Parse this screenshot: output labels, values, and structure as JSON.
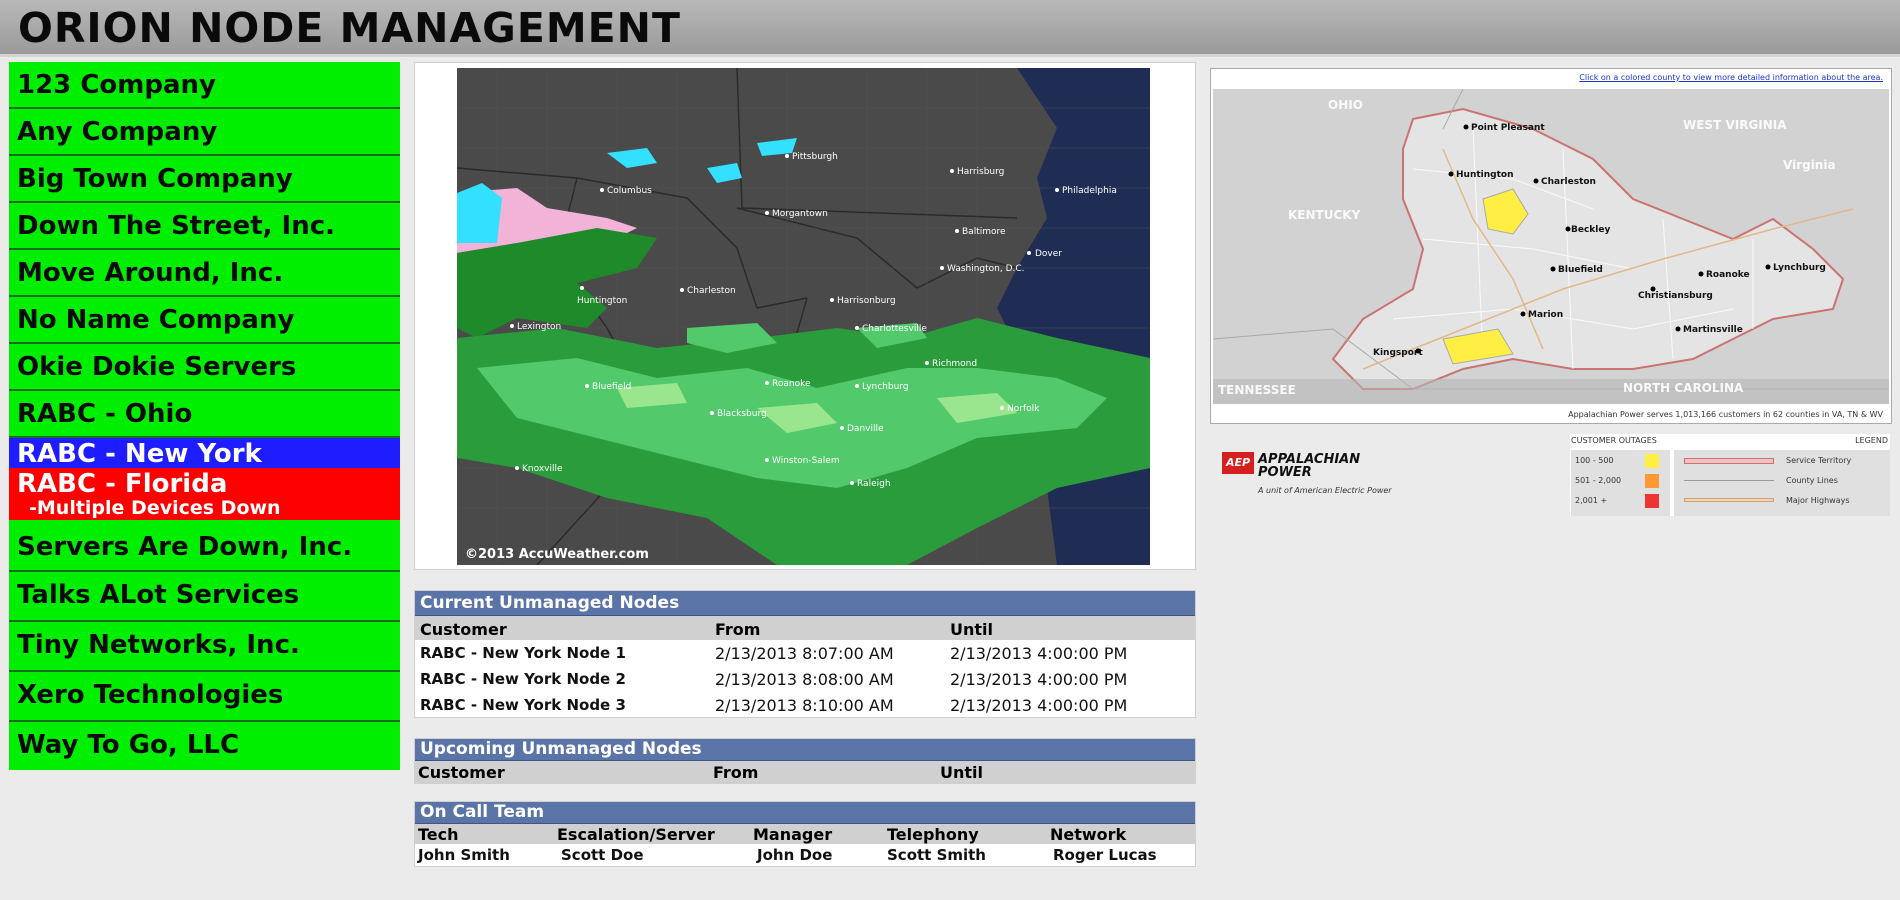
{
  "header": {
    "title": "ORION NODE MANAGEMENT"
  },
  "sidebar": {
    "customers": [
      {
        "name": "123 Company"
      },
      {
        "name": "Any Company"
      },
      {
        "name": "Big Town Company"
      },
      {
        "name": "Down The Street, Inc."
      },
      {
        "name": "Move Around, Inc."
      },
      {
        "name": "No Name Company"
      },
      {
        "name": "Okie Dokie Servers"
      },
      {
        "name": "RABC - Ohio"
      },
      {
        "name": "RABC - New York"
      },
      {
        "name": "RABC - Florida",
        "note": "-Multiple Devices Down"
      },
      {
        "name": "Servers Are Down, Inc."
      },
      {
        "name": "Talks ALot Services"
      },
      {
        "name": "Tiny Networks, Inc."
      },
      {
        "name": "Xero Technologies"
      },
      {
        "name": "Way To Go, LLC"
      }
    ],
    "status_colors": {
      "ok": "#00ee00",
      "selected": "#1d1dff",
      "alert": "#ff0000"
    }
  },
  "weather": {
    "copyright": "©2013 AccuWeather.com",
    "cities": [
      "Pittsburgh",
      "Columbus",
      "Harrisburg",
      "Philadelphia",
      "Morgantown",
      "Baltimore",
      "Dover",
      "Washington, D.C.",
      "Huntington",
      "Charleston",
      "Harrisonburg",
      "Lexington",
      "Charlottesville",
      "Richmond",
      "Lynchburg",
      "Roanoke",
      "Norfolk",
      "Blacksburg",
      "Danville",
      "Knoxville",
      "Winston-Salem",
      "Raleigh",
      "Bluefield"
    ]
  },
  "current_unmanaged": {
    "title": "Current Unmanaged Nodes",
    "columns": [
      "Customer",
      "From",
      "Until"
    ],
    "rows": [
      [
        "RABC - New York Node 1",
        "2/13/2013 8:07:00 AM",
        "2/13/2013 4:00:00 PM"
      ],
      [
        "RABC - New York Node 2",
        "2/13/2013 8:08:00 AM",
        "2/13/2013 4:00:00 PM"
      ],
      [
        "RABC - New York Node 3",
        "2/13/2013 8:10:00 AM",
        "2/13/2013 4:00:00 PM"
      ]
    ]
  },
  "upcoming_unmanaged": {
    "title": "Upcoming Unmanaged Nodes",
    "columns": [
      "Customer",
      "From",
      "Until"
    ]
  },
  "on_call": {
    "title": "On Call Team",
    "columns": [
      "Tech",
      "Escalation/Server",
      "Manager",
      "Telephony",
      "Network"
    ],
    "row": [
      "John Smith",
      "Scott Doe",
      "John Doe",
      "Scott Smith",
      "Roger Lucas"
    ]
  },
  "outage_map": {
    "link": "Click on a colored county to view more detailed information about the area.",
    "caption": "Appalachian Power serves 1,013,166 customers in 62 counties in VA, TN & WV",
    "states": [
      "OHIO",
      "WEST VIRGINIA",
      "KENTUCKY",
      "Virginia",
      "TENNESSEE",
      "NORTH CAROLINA"
    ],
    "cities": [
      "Point Pleasant",
      "Huntington",
      "Charleston",
      "Beckley",
      "Bluefield",
      "Roanoke",
      "Lynchburg",
      "Christiansburg",
      "Marion",
      "Kingsport",
      "Martinsville"
    ],
    "logo": {
      "mark": "AEP",
      "name_line1": "APPALACHIAN",
      "name_line2": "POWER",
      "tagline": "A unit of American Electric Power"
    },
    "legend": {
      "outages_title": "CUSTOMER OUTAGES",
      "legend_title": "LEGEND",
      "outage_ranges": [
        {
          "label": "100 - 500",
          "color": "#ffee44"
        },
        {
          "label": "501 - 2,000",
          "color": "#ff9933"
        },
        {
          "label": "2,001 +",
          "color": "#ee3333"
        }
      ],
      "lines": [
        "Service Territory",
        "County Lines",
        "Major Highways"
      ]
    }
  }
}
